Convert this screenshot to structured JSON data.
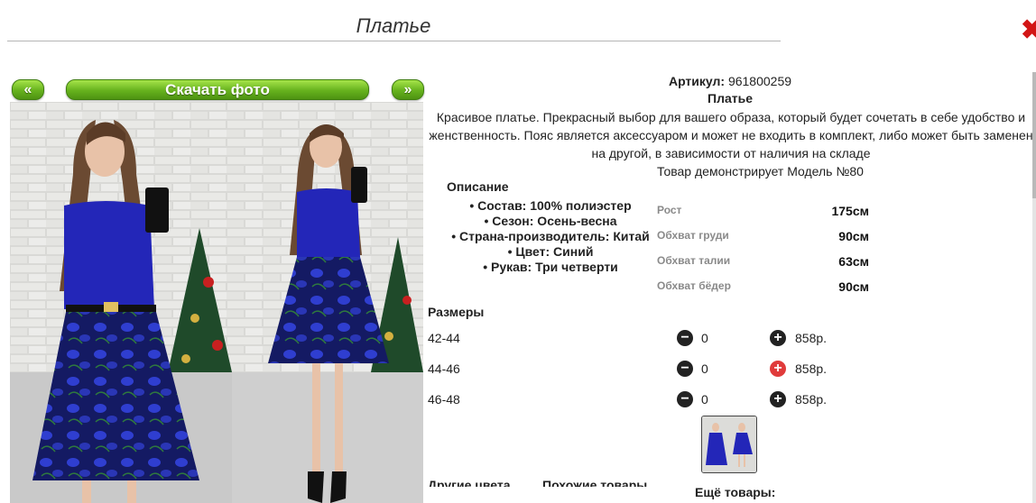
{
  "window": {
    "title": "Платье",
    "close_label": "✖"
  },
  "gallery": {
    "prev_label": "«",
    "next_label": "»",
    "download_label": "Скачать фото"
  },
  "product": {
    "article_label": "Артикул:",
    "article_value": "961800259",
    "name": "Платье",
    "description": "Красивое платье. Прекрасный выбор для вашего образа, который будет сочетать в себе удобство и женственность. Пояс является аксессуаром и может не входить в комплект, либо может быть заменен на другой, в зависимости от наличия на складе",
    "model_note": "Товар демонстрирует Модель №80",
    "description_heading": "Описание",
    "attributes": [
      "Состав: 100% полиэстер",
      "Сезон: Осень-весна",
      "Страна-производитель: Китай",
      "Цвет: Синий",
      "Рукав: Три четверти"
    ],
    "model_params": [
      {
        "label": "Рост",
        "value": "175см"
      },
      {
        "label": "Обхват груди",
        "value": "90см"
      },
      {
        "label": "Обхват талии",
        "value": "63см"
      },
      {
        "label": "Обхват бёдер",
        "value": "90см"
      }
    ],
    "sizes_heading": "Размеры",
    "sizes": [
      {
        "size": "42-44",
        "qty": "0",
        "price": "858р.",
        "minus": "−",
        "plus": "+"
      },
      {
        "size": "44-46",
        "qty": "0",
        "price": "858р.",
        "minus": "−",
        "plus": "+"
      },
      {
        "size": "46-48",
        "qty": "0",
        "price": "858р.",
        "minus": "−",
        "plus": "+"
      }
    ],
    "more_heading": "Ещё товары:",
    "other_colors_heading": "Другие цвета",
    "similar_heading": "Похожие товары"
  },
  "colors": {
    "dress": "#2326b8",
    "button_green": "#66b21d",
    "close_red": "#d21515",
    "plus_active": "#e03b3b"
  },
  "icons": {
    "minus": "minus-circle-icon",
    "plus": "plus-circle-icon",
    "close": "close-icon"
  }
}
